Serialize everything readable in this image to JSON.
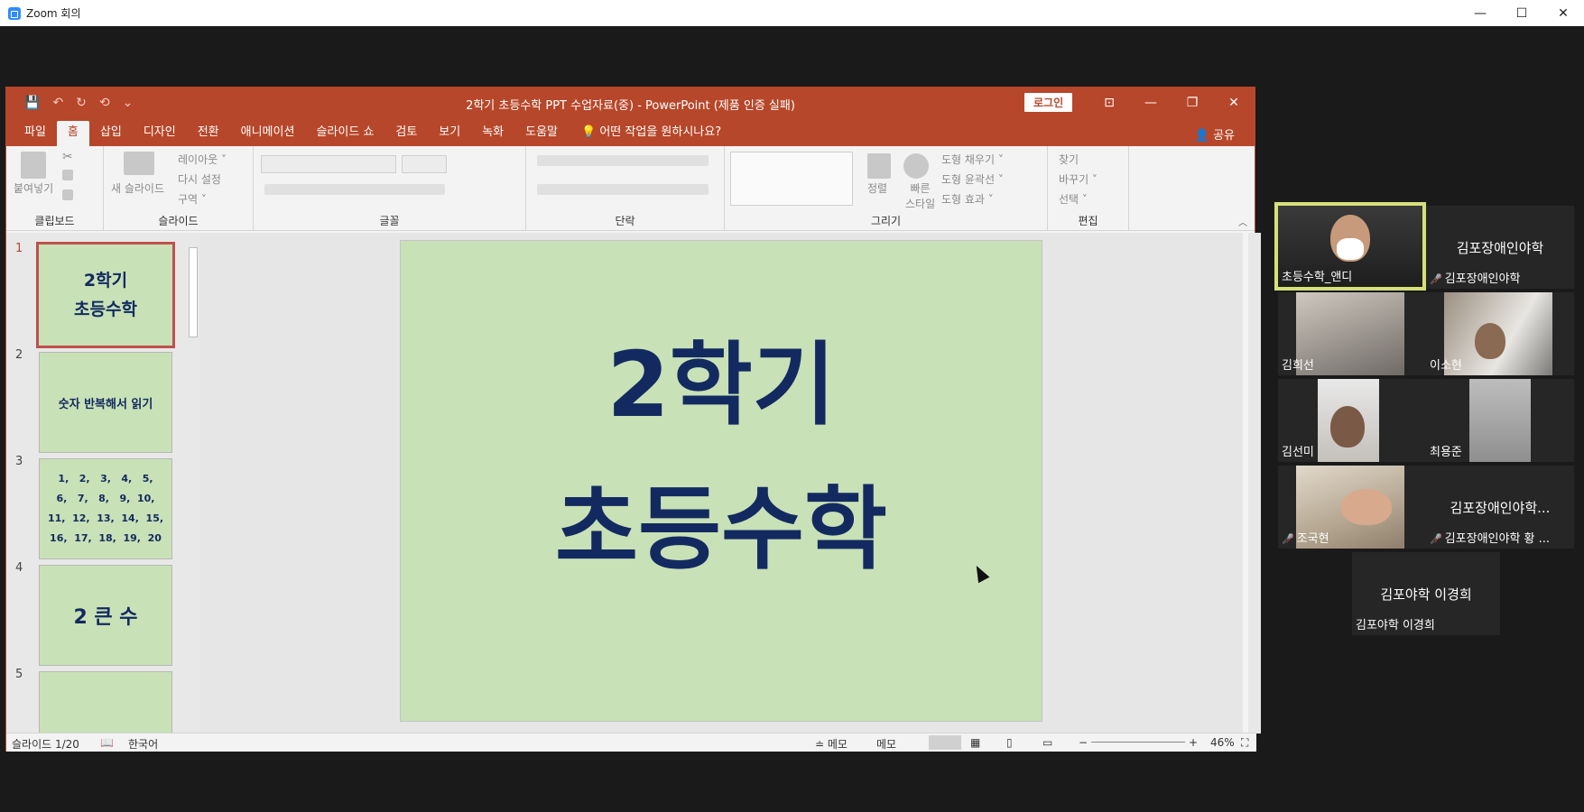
{
  "zoom": {
    "title": "Zoom 회의",
    "controls": [
      "—",
      "☐",
      "✕"
    ]
  },
  "ppt": {
    "qat": [
      "💾",
      "↶",
      "↻",
      "⟲",
      "⌄"
    ],
    "title": "2학기 초등수학 PPT 수업자료(중)  -  PowerPoint (제품 인증 실패)",
    "login": "로그인",
    "win": [
      "⊡",
      "—",
      "❐",
      "✕"
    ],
    "tabs": [
      "파일",
      "홈",
      "삽입",
      "디자인",
      "전환",
      "애니메이션",
      "슬라이드 쇼",
      "검토",
      "보기",
      "녹화",
      "도움말"
    ],
    "tellme": "💡  어떤 작업을 원하시나요?",
    "share": "👤 공유",
    "ribbon": {
      "groups": [
        "클립보드",
        "슬라이드",
        "글꼴",
        "단락",
        "그리기",
        "편집"
      ],
      "paste": "붙여넣기",
      "new_slide": "새 슬라이드",
      "layout": "레이아웃 ˅",
      "reset": "다시 설정",
      "section": "구역 ˅",
      "arrange": "정렬",
      "quick_styles": "빠른\n스타일",
      "fill": "도형 채우기 ˅",
      "outline": "도형 윤곽선 ˅",
      "effects": "도형 효과 ˅",
      "find": "찾기",
      "replace": "바꾸기 ˅",
      "select": "선택 ˅"
    },
    "thumbs": [
      {
        "num": "1",
        "text": "2학기\n초등수학"
      },
      {
        "num": "2",
        "text": "숫자 반복해서 읽기"
      },
      {
        "num": "3",
        "text": "1,   2,   3,   4,   5,\n6,   7,   8,   9,  10,\n11,  12,  13,  14,  15,\n16,  17,  18,  19,  20"
      },
      {
        "num": "4",
        "text": "2 큰 수"
      },
      {
        "num": "5",
        "text": ""
      }
    ],
    "slide": {
      "line1": "2학기",
      "line2": "초등수학"
    },
    "status": {
      "slide_num": "슬라이드 1/20",
      "lang": "한국어",
      "notes1": "≐ 메모",
      "notes2": "메모",
      "zoom_minus": "−",
      "zoom_plus": "+",
      "zoom": "46%"
    }
  },
  "participants": [
    {
      "name": "초등수학_앤디",
      "video": true,
      "active": true,
      "muted": false
    },
    {
      "name": "김포장애인야학",
      "big": "김포장애인야학",
      "video": false,
      "muted": true
    },
    {
      "name": "김희선",
      "video": true,
      "muted": false
    },
    {
      "name": "이소현",
      "video": true,
      "muted": false
    },
    {
      "name": "김선미",
      "video": true,
      "muted": false
    },
    {
      "name": "최용준",
      "video": true,
      "muted": false
    },
    {
      "name": "조국현",
      "video": true,
      "muted": true
    },
    {
      "name": "김포장애인야학   황 ...",
      "big": "김포장애인야학...",
      "video": false,
      "muted": true
    },
    {
      "name": "김포야학 이경희",
      "big": "김포야학 이경희",
      "video": false,
      "muted": false
    }
  ],
  "colors": {
    "ppt_accent": "#b7472a",
    "slide_bg": "#c8e1b6",
    "slide_text": "#132a61",
    "active_speaker": "#d6e07a"
  }
}
